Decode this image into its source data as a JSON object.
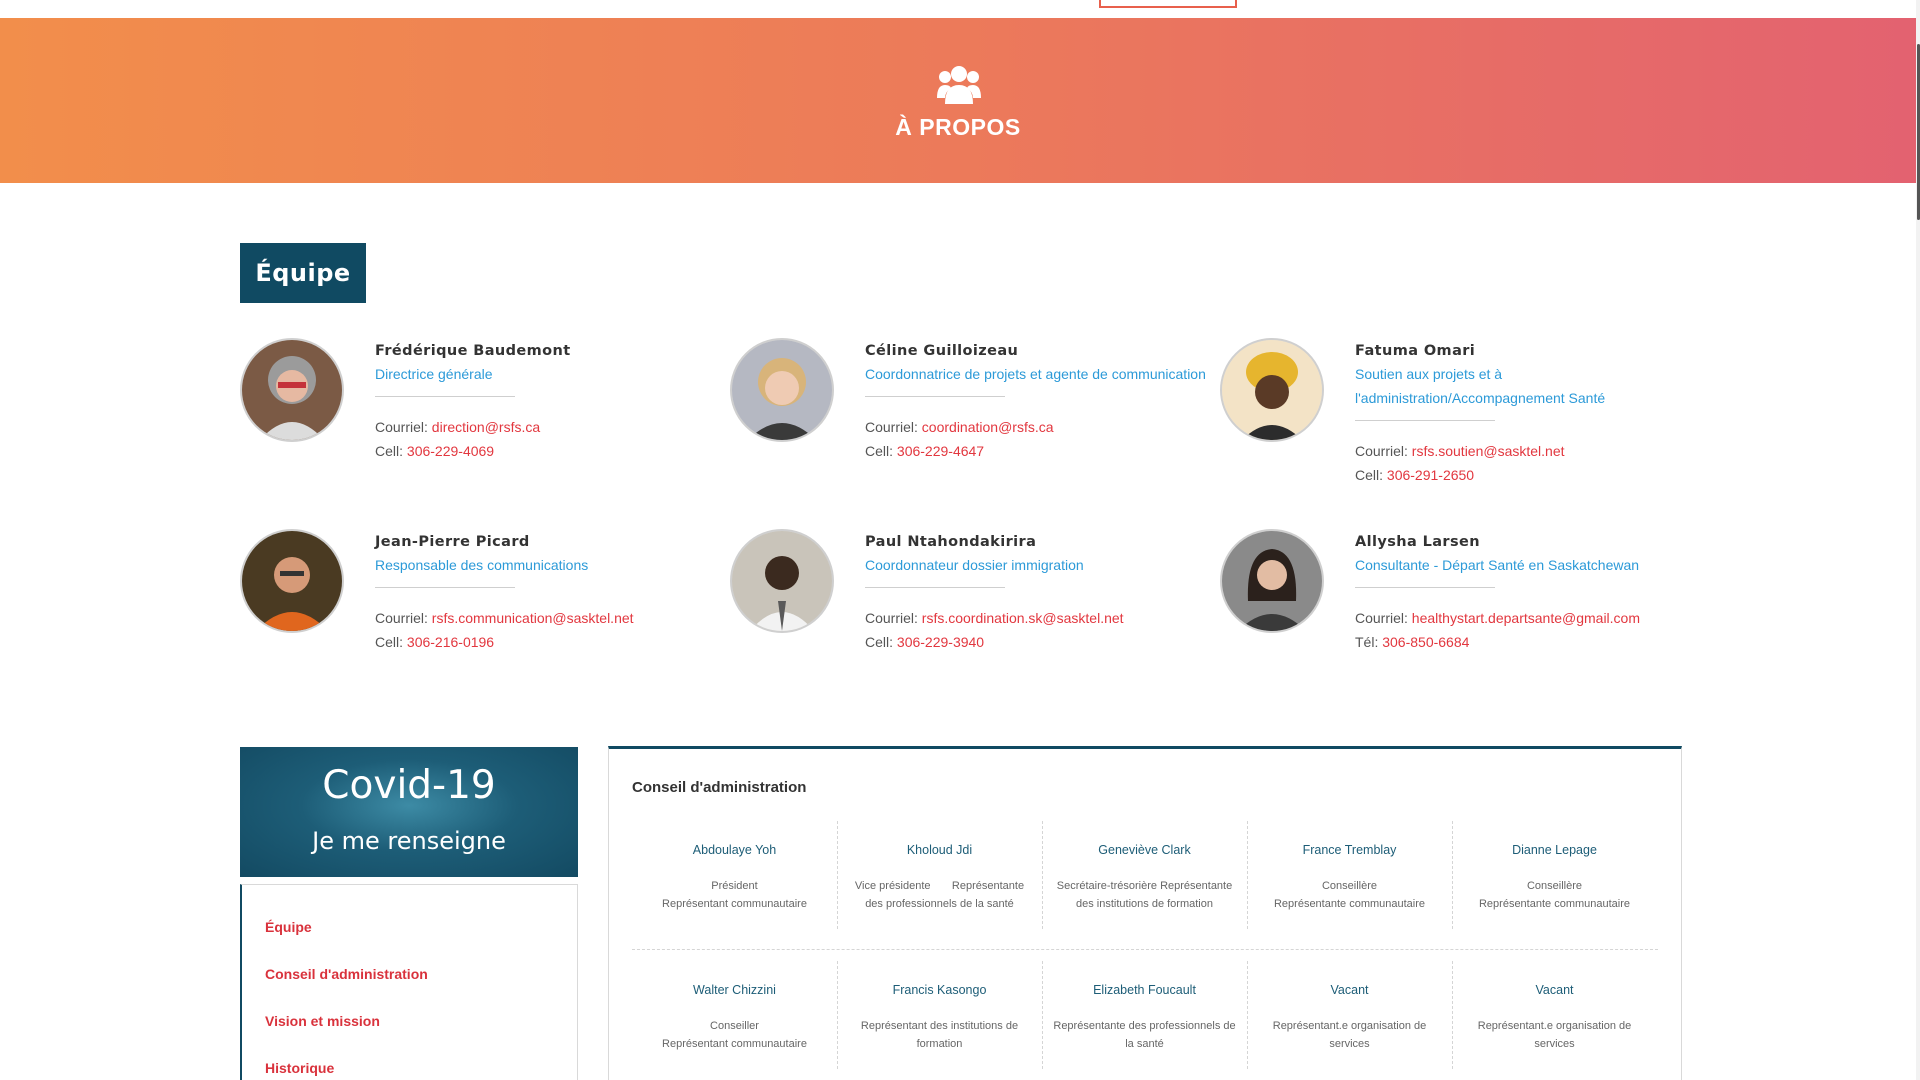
{
  "hero": {
    "icon": "users-icon",
    "title": "À PROPOS"
  },
  "team": {
    "heading": "Équipe",
    "members": [
      {
        "name": "Frédérique Baudemont",
        "role": "Directrice générale",
        "email_label": "Courriel:",
        "email": "direction@rsfs.ca",
        "phone_label": "Cell:",
        "phone": "306-229-4069"
      },
      {
        "name": "Céline Guilloizeau",
        "role": "Coordonnatrice de projets et agente de communication",
        "email_label": "Courriel:",
        "email": "coordination@rsfs.ca",
        "phone_label": "Cell:",
        "phone": "306-229-4647"
      },
      {
        "name": "Fatuma Omari",
        "role": "Soutien aux projets et à l'administration/Accompagnement Santé",
        "email_label": "Courriel:",
        "email": "rsfs.soutien@sasktel.net",
        "phone_label": "Cell:",
        "phone": "306-291-2650"
      },
      {
        "name": "Jean-Pierre Picard",
        "role": "Responsable des communications",
        "email_label": "Courriel:",
        "email": "rsfs.communication@sasktel.net",
        "phone_label": "Cell:",
        "phone": "306-216-0196"
      },
      {
        "name": "Paul Ntahondakirira",
        "role": "Coordonnateur dossier immigration",
        "email_label": "Courriel:",
        "email": "rsfs.coordination.sk@sasktel.net",
        "phone_label": "Cell:",
        "phone": "306-229-3940"
      },
      {
        "name": "Allysha Larsen",
        "role": "Consultante - Départ Santé en Saskatchewan",
        "email_label": "Courriel:",
        "email": "healthystart.departsante@gmail.com",
        "phone_label": "Tél:",
        "phone": "306-850-6684"
      }
    ]
  },
  "covid": {
    "line1": "Covid-19",
    "line2": "Je me renseigne"
  },
  "sidenav": {
    "items": [
      "Équipe",
      "Conseil d'administration",
      "Vision et mission",
      "Historique"
    ]
  },
  "board": {
    "title": "Conseil d'administration",
    "rows": [
      [
        {
          "name": "Abdoulaye Yoh",
          "desc1": "Président",
          "desc2": "Représentant communautaire"
        },
        {
          "name": "Kholoud Jdi",
          "desc1": "Vice présidente       Représentante",
          "desc2": "des professionnels de la santé"
        },
        {
          "name": "Geneviève Clark",
          "desc1": "Secrétaire-trésorière Représentante",
          "desc2": "des institutions de formation"
        },
        {
          "name": "France Tremblay",
          "desc1": "Conseillère",
          "desc2": "Représentante communautaire"
        },
        {
          "name": "Dianne Lepage",
          "desc1": "Conseillère",
          "desc2": "Représentante communautaire"
        }
      ],
      [
        {
          "name": "Walter Chizzini",
          "desc1": "Conseiller",
          "desc2": "Représentant communautaire"
        },
        {
          "name": "Francis Kasongo",
          "desc1": "Représentant des institutions de",
          "desc2": "formation"
        },
        {
          "name": "Elizabeth Foucault",
          "desc1": "Représentante des professionnels de",
          "desc2": "la santé"
        },
        {
          "name": "Vacant",
          "desc1": "Représentant.e organisation de",
          "desc2": "services"
        },
        {
          "name": "Vacant",
          "desc1": "Représentant.e organisation de",
          "desc2": "services"
        }
      ]
    ]
  },
  "colors": {
    "brand_dark": "#104a62",
    "link_red": "#e2373f",
    "role_blue": "#2c9ad8",
    "hero_start": "#f28e4b",
    "hero_end": "#e36270"
  }
}
